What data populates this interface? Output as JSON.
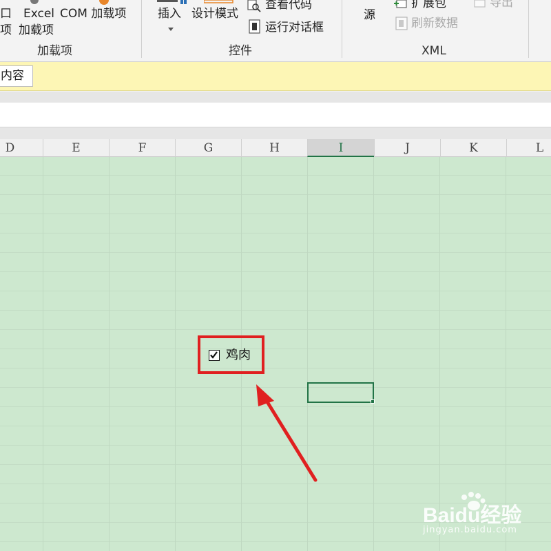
{
  "ribbon": {
    "addins_group": {
      "partial_item_top": "口",
      "partial_item_bottom": "项",
      "excel_line1": "Excel",
      "excel_line2": "加载项",
      "com_label": "COM 加载项",
      "group_label": "加载项"
    },
    "controls_group": {
      "insert_label": "插入",
      "design_mode_label": "设计模式",
      "view_code_label": "查看代码",
      "run_dialog_label": "运行对话框",
      "group_label": "控件"
    },
    "xml_group": {
      "source_label": "源",
      "expansion_pack_label": "扩展包",
      "refresh_data_label": "刷新数据",
      "export_label": "导出",
      "group_label": "XML"
    }
  },
  "message_bar": {
    "button_label": "内容"
  },
  "columns": [
    "D",
    "E",
    "F",
    "G",
    "H",
    "I",
    "J",
    "K",
    "L"
  ],
  "selected_column": "I",
  "checkbox": {
    "label": "鸡肉",
    "checked": true
  },
  "colors": {
    "grid_fill": "#cde8cf",
    "selection": "#217346",
    "highlight": "#e02020"
  },
  "watermark": {
    "brand": "Baidu经验",
    "url": "jingyan.baidu.com"
  }
}
